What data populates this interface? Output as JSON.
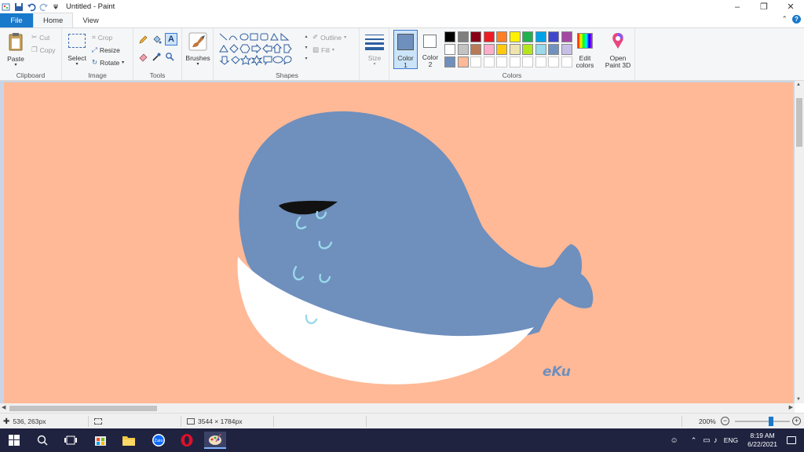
{
  "window": {
    "title": "Untitled - Paint"
  },
  "menu": {
    "file": "File",
    "home": "Home",
    "view": "View"
  },
  "ribbon": {
    "clipboard": {
      "label": "Clipboard",
      "paste": "Paste",
      "cut": "Cut",
      "copy": "Copy"
    },
    "image": {
      "label": "Image",
      "select": "Select",
      "crop": "Crop",
      "resize": "Resize",
      "rotate": "Rotate"
    },
    "tools": {
      "label": "Tools"
    },
    "brushes": {
      "label": "Brushes"
    },
    "shapes": {
      "label": "Shapes",
      "outline": "Outline",
      "fill": "Fill"
    },
    "size": {
      "label": "Size"
    },
    "colors": {
      "label": "Colors",
      "color1_line1": "Color",
      "color1_line2": "1",
      "color2_line1": "Color",
      "color2_line2": "2",
      "edit_line1": "Edit",
      "edit_line2": "colors",
      "color1_value": "#6f8fbd",
      "color2_value": "#ffffff",
      "palette_row1": [
        "#000000",
        "#7f7f7f",
        "#880015",
        "#ed1c24",
        "#ff7f27",
        "#fff200",
        "#22b14c",
        "#00a2e8",
        "#3f48cc",
        "#a349a4"
      ],
      "palette_row2": [
        "#ffffff",
        "#c3c3c3",
        "#b97a57",
        "#ffaec9",
        "#ffc90e",
        "#efe4b0",
        "#b5e61d",
        "#99d9ea",
        "#7092be",
        "#c8bfe7"
      ],
      "custom_row": [
        "#6f8fbd",
        "#ffb996",
        "",
        "",
        "",
        "",
        "",
        "",
        "",
        ""
      ]
    },
    "paint3d": {
      "line1": "Open",
      "line2": "Paint 3D"
    }
  },
  "canvas": {
    "background": "#ffb996",
    "whale_body": "#6f8fbd",
    "whale_belly": "#ffffff",
    "tear_color": "#99d9ea",
    "signature": "eKu"
  },
  "status": {
    "cursor_pos": "536, 263px",
    "image_size": "3544 × 1784px",
    "zoom": "200%",
    "zoom_fraction": 0.67
  },
  "taskbar": {
    "lang": "ENG",
    "time": "8:19 AM",
    "date": "6/22/2021"
  }
}
